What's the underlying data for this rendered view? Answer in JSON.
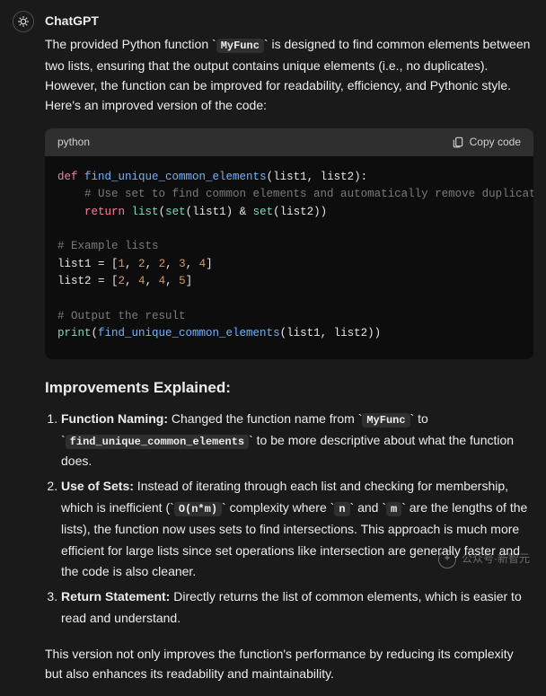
{
  "author": "ChatGPT",
  "intro": {
    "pre1": "The provided Python function ",
    "code1": "MyFunc",
    "post1": " is designed to find common elements between two lists, ensuring that the output contains unique elements (i.e., no duplicates). However, the function can be improved for readability, efficiency, and Pythonic style. Here's an improved version of the code:"
  },
  "code": {
    "lang": "python",
    "copy_label": "Copy code",
    "tokens": {
      "def": "def",
      "fn_name": "find_unique_common_elements",
      "sig_tail": "(list1, list2):",
      "c1": "# Use set to find common elements and automatically remove duplicates",
      "ret": "return",
      "bi_list": "list",
      "paren_open": "(",
      "bi_set1": "set",
      "set1_call": "(list1)",
      "amp": " & ",
      "bi_set2": "set",
      "set2_call": "(list2))",
      "c2": "# Example lists",
      "l1_pre": "list1 = [",
      "l1_nums": [
        "1",
        "2",
        "2",
        "3",
        "4"
      ],
      "l1_close": "]",
      "l2_pre": "list2 = [",
      "l2_nums": [
        "2",
        "4",
        "4",
        "5"
      ],
      "l2_close": "]",
      "c3": "# Output the result",
      "bi_print": "print",
      "print_call_open": "(",
      "print_fn": "find_unique_common_elements",
      "print_call_tail": "(list1, list2))"
    }
  },
  "improvements_heading": "Improvements Explained:",
  "improvements": [
    {
      "lead": "Function Naming:",
      "pre": " Changed the function name from ",
      "code1": "MyFunc",
      "mid": " to ",
      "code2": "find_unique_common_elements",
      "post": " to be more descriptive about what the function does."
    },
    {
      "lead": "Use of Sets:",
      "pre": " Instead of iterating through each list and checking for membership, which is inefficient (",
      "code1": "O(n*m)",
      "mid": " complexity where ",
      "code2": "n",
      "mid2": " and ",
      "code3": "m",
      "post": " are the lengths of the lists), the function now uses sets to find intersections. This approach is much more efficient for large lists since set operations like intersection are generally faster and the code is also cleaner."
    },
    {
      "lead": "Return Statement:",
      "pre": " Directly returns the list of common elements, which is easier to read and understand.",
      "code1": "",
      "mid": "",
      "code2": "",
      "post": ""
    }
  ],
  "closing": "This version not only improves the function's performance by reducing its complexity but also enhances its readability and maintainability.",
  "watermark": {
    "label": "公众号·新智元"
  }
}
